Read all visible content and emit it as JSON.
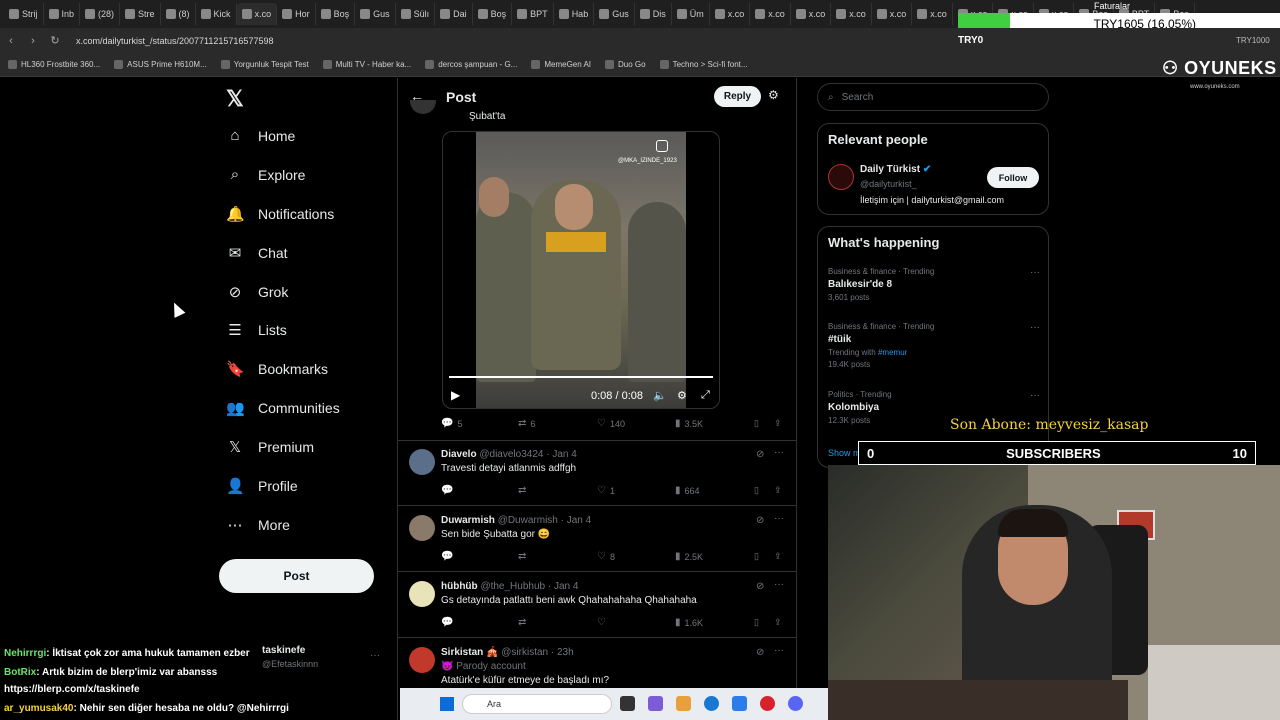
{
  "browser": {
    "tabs": [
      "Strij",
      "Inb",
      "(28)",
      "Stre",
      "(8)",
      "Kick",
      "x.co",
      "Hor",
      "Boş",
      "Gus",
      "Sülı",
      "Dai",
      "Boş",
      "BPT",
      "Hab",
      "Gus",
      "Dis",
      "Üm",
      "x.co",
      "x.co",
      "x.co",
      "x.co",
      "x.co",
      "x.co",
      "x.co",
      "x.co",
      "x.co",
      "Boş",
      "BPT",
      "Boş"
    ],
    "url": "x.com/dailyturkist_/status/2007711215716577598",
    "profile_label": "TRY0",
    "right_label": "TRY1000",
    "bookmarks": [
      "HL360 Frostbite 360...",
      "ASUS Prime H610M...",
      "Yorgunluk Tespit Test",
      "Multi TV - Haber ka...",
      "dercos şampuan - G...",
      "MemeGen AI",
      "Duo Go",
      "Techno > Sci-fi font..."
    ]
  },
  "overlay_money": {
    "label": "Faturalar",
    "text": "TRY1605 (16.05%)",
    "progress_fraction": 0.16
  },
  "nav": {
    "items": [
      "Home",
      "Explore",
      "Notifications",
      "Chat",
      "Grok",
      "Lists",
      "Bookmarks",
      "Communities",
      "Premium",
      "Profile",
      "More"
    ],
    "post_button": "Post"
  },
  "post": {
    "header_title": "Post",
    "reply_button": "Reply",
    "text_tail": "Şubat'ta",
    "video": {
      "watermark": "@MKA_IZINDE_1923",
      "time": "0:08 / 0:08"
    },
    "stats": {
      "replies": "5",
      "reposts": "6",
      "likes": "140",
      "views": "3.5K"
    }
  },
  "replies": [
    {
      "name": "Diavelo",
      "handle": "@diavelo3424 · Jan 4",
      "text": "Travesti detayi atlanmis adffgh",
      "replies": "",
      "reposts": "",
      "likes": "1",
      "views": "664",
      "avatar_color": "#5b6f8a"
    },
    {
      "name": "Duwarmish",
      "handle": "@Duwarmish · Jan 4",
      "text": "Sen bide Şubatta gor 😄",
      "replies": "",
      "reposts": "",
      "likes": "8",
      "views": "2.5K",
      "avatar_color": "#8a7a6a"
    },
    {
      "name": "hübhüb",
      "handle": "@the_Hubhub · Jan 4",
      "text": "Gs detayında patlattı beni awk Qhahahahaha Qhahahaha",
      "replies": "",
      "reposts": "",
      "likes": "",
      "views": "1.6K",
      "avatar_color": "#e8e3b8"
    },
    {
      "name": "Sirkistan 🎪",
      "handle": "@sirkistan · 23h",
      "text": "Atatürk'e küfür etmeye de başladı mı?",
      "badge": "😈 Parody account",
      "avatar_color": "#c0392b"
    }
  ],
  "right": {
    "search_placeholder": "Search",
    "relevant_title": "Relevant people",
    "person": {
      "name": "Daily Türkist",
      "handle": "@dailyturkist_",
      "bio": "İletişim için | dailyturkist@gmail.com",
      "follow": "Follow"
    },
    "happening_title": "What's happening",
    "trends": [
      {
        "category": "Business & finance · Trending",
        "title": "Balıkesir'de 8",
        "count": "3,601 posts"
      },
      {
        "category": "Business & finance · Trending",
        "title": "#tüik",
        "count": "19.4K posts",
        "with_prefix": "Trending with",
        "with": "#memur"
      },
      {
        "category": "Politics · Trending",
        "title": "Kolombiya",
        "count": "12.3K posts"
      }
    ],
    "show_more": "Show more"
  },
  "stream": {
    "logo": "OYUNEKS",
    "logo_sub": "www.oyuneks.com",
    "son_abone": "Son Abone: meyvesiz_kasap",
    "subs_label": "SUBSCRIBERS",
    "subs_left": "0",
    "subs_right": "10",
    "chat": [
      {
        "user": "Nehirrrgi",
        "msg": ": İktisat çok zor ama hukuk tamamen ezber"
      },
      {
        "user": "BotRix",
        "msg": ": Artık bizim de blerp'imiz var abansss"
      },
      {
        "user": "",
        "msg": "https://blerp.com/x/taskinefe"
      },
      {
        "user": "ar_yumusak40",
        "msg": ": Nehir sen diğer hesaba ne oldu? @Nehirrrgi"
      }
    ],
    "account_name": "taskinefe",
    "account_handle": "@Efetaskinnn"
  },
  "taskbar": {
    "search_placeholder": "Ara"
  }
}
